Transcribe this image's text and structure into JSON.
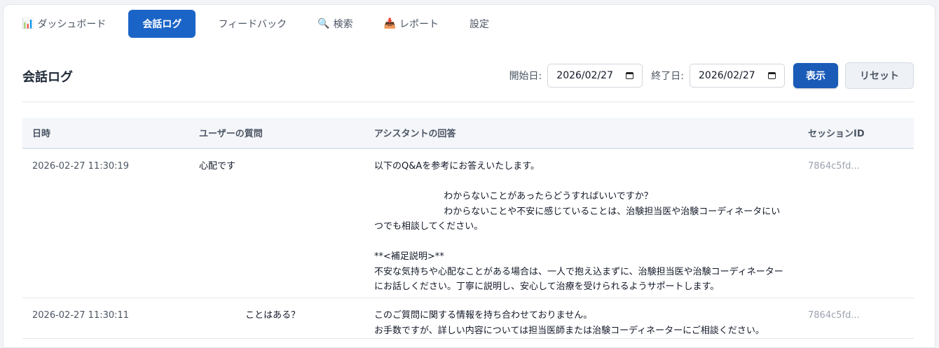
{
  "nav": {
    "tabs": [
      {
        "label": "ダッシュボード",
        "icon": "📊",
        "active": false
      },
      {
        "label": "会話ログ",
        "icon": "",
        "active": true
      },
      {
        "label": "フィードバック",
        "icon": "",
        "active": false
      },
      {
        "label": "検索",
        "icon": "🔍",
        "active": false
      },
      {
        "label": "レポート",
        "icon": "📥",
        "active": false
      },
      {
        "label": "設定",
        "icon": "",
        "active": false
      }
    ]
  },
  "page": {
    "title": "会話ログ",
    "start_label": "開始日:",
    "start_value": "2026/02/27",
    "end_label": "終了日:",
    "end_value": "2026/02/27",
    "show_button": "表示",
    "reset_button": "リセット"
  },
  "table": {
    "headers": [
      "日時",
      "ユーザーの質問",
      "アシスタントの回答",
      "セッションID"
    ],
    "rows": [
      {
        "datetime": "2026-02-27 11:30:19",
        "question": "心配です",
        "answer": "以下のQ&Aを参考にお答えいたします。\n\n\t\t\tわからないことがあったらどうすればいいですか？\n\t\t\tわからないことや不安に感じていることは、治験担当医や治験コーディネータにいつでも相談してください。\n\n**<補足説明>**\n不安な気持ちや心配なことがある場合は、一人で抱え込まずに、治験担当医や治験コーディネーターにお話しください。丁寧に説明し、安心して治療を受けられるようサポートします。",
        "session": "7864c5fd..."
      },
      {
        "datetime": "2026-02-27 11:30:11",
        "question": "\t\tことはある？",
        "answer": "このご質問に関する情報を持ち合わせておりません。\nお手数ですが、詳しい内容については担当医師または治験コーディネーターにご相談ください。",
        "session": "7864c5fd..."
      }
    ]
  }
}
